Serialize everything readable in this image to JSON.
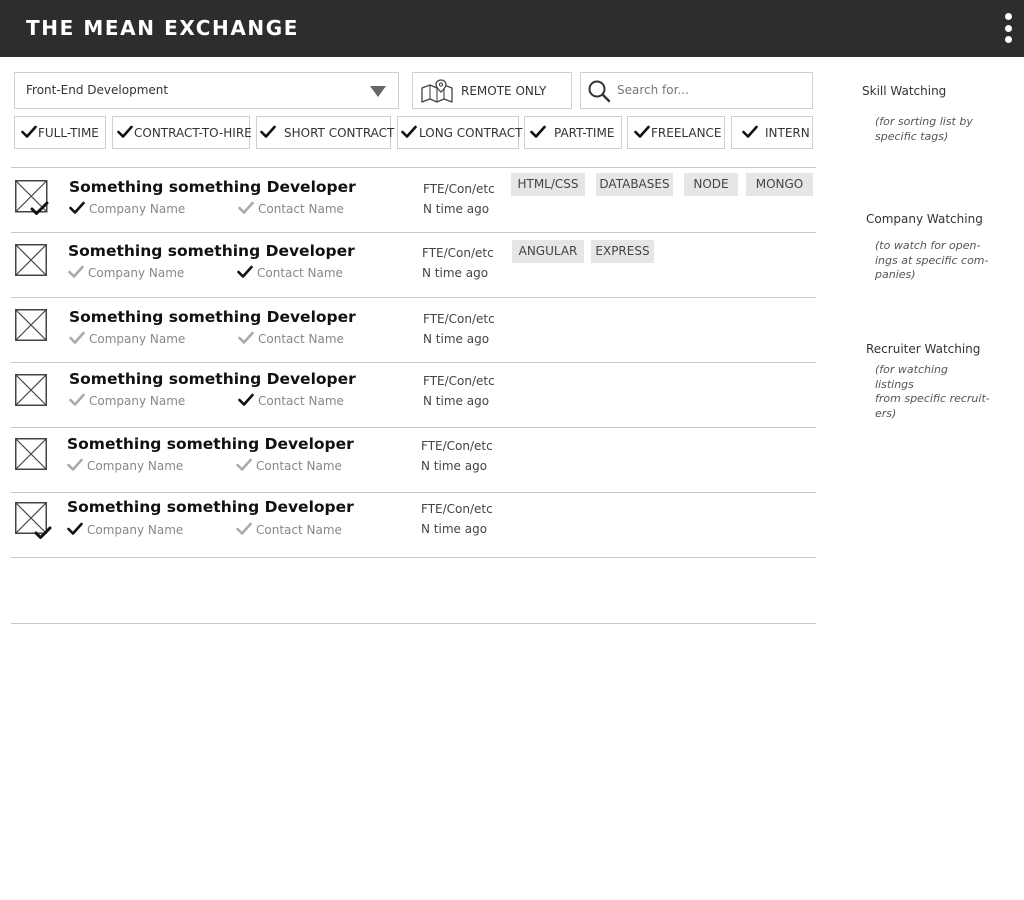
{
  "header": {
    "title": "THE MEAN EXCHANGE"
  },
  "filters": {
    "category": "Front-End Development",
    "remote_label": "REMOTE ONLY",
    "search_placeholder": "Search for..."
  },
  "job_types": [
    {
      "label": "FULL-TIME",
      "checked": true
    },
    {
      "label": "CONTRACT-TO-HIRE",
      "checked": true
    },
    {
      "label": "SHORT CONTRACT",
      "checked": true
    },
    {
      "label": "LONG CONTRACT",
      "checked": true
    },
    {
      "label": "PART-TIME",
      "checked": true
    },
    {
      "label": "FREELANCE",
      "checked": true
    },
    {
      "label": "INTERN",
      "checked": true
    }
  ],
  "listings": [
    {
      "title": "Something something Developer",
      "company": "Company Name",
      "contact": "Contact Name",
      "type": "FTE/Con/etc",
      "time": "N time ago",
      "company_watched": true,
      "contact_watched": false,
      "marked": true,
      "tags": [
        "HTML/CSS",
        "DATABASES",
        "NODE",
        "MONGO"
      ]
    },
    {
      "title": "Something something Developer",
      "company": "Company Name",
      "contact": "Contact Name",
      "type": "FTE/Con/etc",
      "time": "N time ago",
      "company_watched": false,
      "contact_watched": true,
      "marked": false,
      "tags": [
        "ANGULAR",
        "EXPRESS"
      ]
    },
    {
      "title": "Something something Developer",
      "company": "Company Name",
      "contact": "Contact Name",
      "type": "FTE/Con/etc",
      "time": "N time ago",
      "company_watched": false,
      "contact_watched": false,
      "marked": false,
      "tags": []
    },
    {
      "title": "Something something Developer",
      "company": "Company Name",
      "contact": "Contact Name",
      "type": "FTE/Con/etc",
      "time": "N time ago",
      "company_watched": false,
      "contact_watched": true,
      "marked": false,
      "tags": []
    },
    {
      "title": "Something something Developer",
      "company": "Company Name",
      "contact": "Contact Name",
      "type": "FTE/Con/etc",
      "time": "N time ago",
      "company_watched": false,
      "contact_watched": false,
      "marked": false,
      "tags": []
    },
    {
      "title": "Something something Developer",
      "company": "Company Name",
      "contact": "Contact Name",
      "type": "FTE/Con/etc",
      "time": "N time ago",
      "company_watched": true,
      "contact_watched": false,
      "marked": true,
      "tags": []
    }
  ],
  "sidebar": {
    "skill": {
      "heading": "Skill Watching",
      "desc": [
        "(for sorting list by",
        "specific tags)"
      ]
    },
    "company": {
      "heading": "Company Watching",
      "desc": [
        "(to watch for open-",
        "ings at specific com-",
        "panies)"
      ]
    },
    "recruiter": {
      "heading": "Recruiter Watching",
      "desc": [
        "(for watching listings",
        "from specific recruit-",
        "ers)"
      ]
    }
  },
  "colors": {
    "header_bg": "#2d2d2d",
    "check_on": "#111111",
    "check_off": "#aaaaaa",
    "tag_bg": "#e6e6e6"
  }
}
